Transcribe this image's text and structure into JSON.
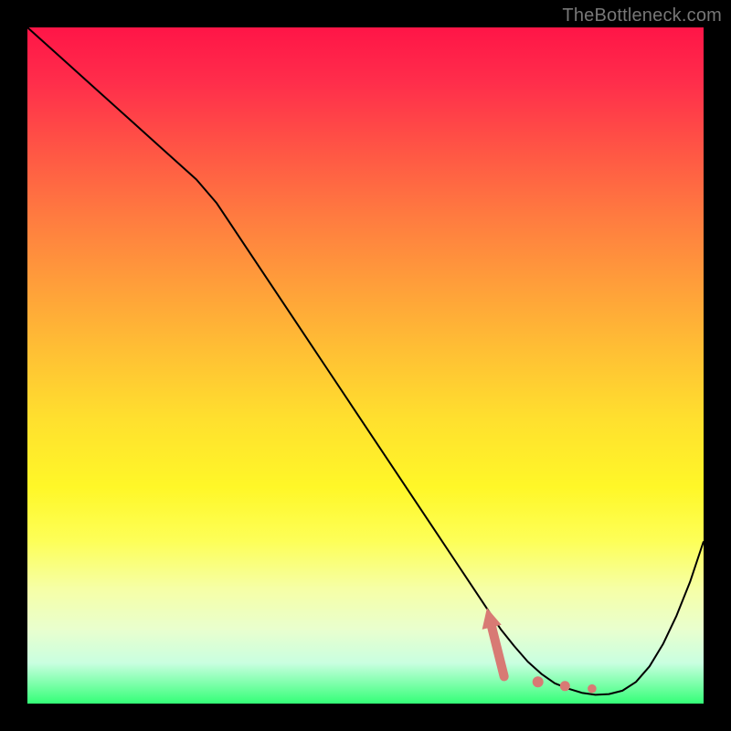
{
  "attribution": "TheBottleneck.com",
  "colors": {
    "background": "#000000",
    "gradient_top": "#ff1547",
    "gradient_mid": "#fff728",
    "gradient_bottom": "#34ff77",
    "curve": "#000000",
    "arrow": "#d87a74",
    "attribution_text": "#777777"
  },
  "chart_data": {
    "type": "line",
    "title": "",
    "xlabel": "",
    "ylabel": "",
    "xlim": [
      0,
      100
    ],
    "ylim": [
      0,
      100
    ],
    "series": [
      {
        "name": "bottleneck-curve",
        "x": [
          0,
          5,
          10,
          15,
          20,
          25,
          28,
          32,
          36,
          40,
          44,
          48,
          52,
          56,
          60,
          64,
          68,
          70,
          72,
          74,
          76,
          78,
          80,
          82,
          84,
          86,
          88,
          90,
          92,
          94,
          96,
          98,
          100
        ],
        "y": [
          100,
          95.5,
          91,
          86.5,
          82,
          77.5,
          74,
          68,
          62,
          56,
          50,
          44,
          38,
          32,
          26,
          20,
          14,
          11,
          8.5,
          6.2,
          4.4,
          3.0,
          2.2,
          1.6,
          1.3,
          1.4,
          1.9,
          3.2,
          5.5,
          8.8,
          13,
          18,
          24
        ]
      }
    ],
    "pointer": {
      "arrow_tip_x": 68,
      "arrow_tip_y": 14,
      "base_x": 70.5,
      "base_y": 4,
      "dots": [
        {
          "x": 75.5,
          "y": 3.2
        },
        {
          "x": 79.5,
          "y": 2.6
        },
        {
          "x": 83.5,
          "y": 2.2
        }
      ]
    },
    "annotations": []
  }
}
